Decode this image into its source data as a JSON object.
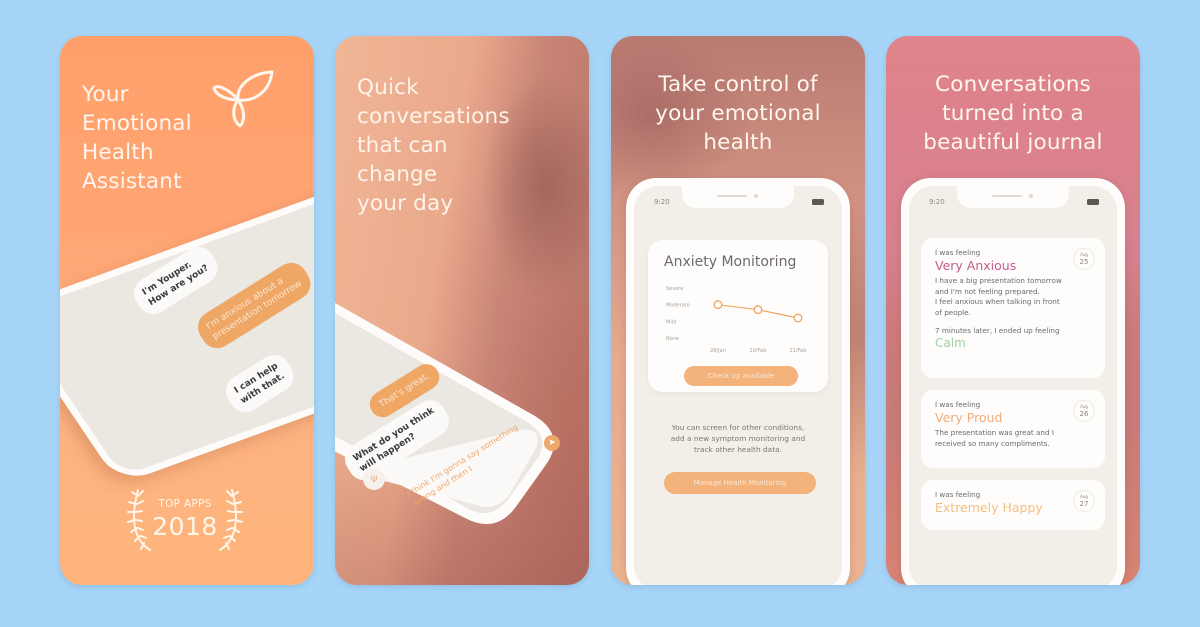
{
  "colors": {
    "background": "#a6d5f8",
    "accent_orange": "#efa766",
    "button_orange": "#f3b27a",
    "anxious_pink": "#c25b8d",
    "proud_orange": "#f2ab78",
    "happy_orange": "#f5be7c",
    "calm_green": "#9fd0a0"
  },
  "panels": [
    {
      "headline": [
        "Your",
        "Emotional",
        "Health",
        "Assistant"
      ],
      "logo_icon": "leaf-bird-logo-icon",
      "chat": [
        {
          "from": "bot",
          "text": [
            "I'm Youper.",
            "How are you?"
          ]
        },
        {
          "from": "user",
          "text": [
            "I'm anxious about a",
            "presentation tomorrow"
          ]
        },
        {
          "from": "bot",
          "text": [
            "I can help",
            "with that."
          ]
        }
      ],
      "award": {
        "label": "TOP APPS",
        "year": "2018",
        "icon": "laurel-wreath-icon"
      }
    },
    {
      "headline": [
        "Quick",
        "conversations",
        "that can",
        "change",
        "your day"
      ],
      "chat": [
        {
          "from": "user",
          "text": [
            "That's great."
          ]
        },
        {
          "from": "bot",
          "text": [
            "What do you think",
            "will happen?"
          ]
        },
        {
          "from": "user",
          "text": [
            "I think I'm gonna say something",
            "wrong and then I"
          ]
        }
      ],
      "send_icon": "send-arrow-icon",
      "avatar_icon": "youper-logo-icon"
    },
    {
      "headline": [
        "Take control of",
        "your emotional",
        "health"
      ],
      "status_time": "9:20",
      "monitor": {
        "title": "Anxiety Monitoring",
        "check_button": "Check up available",
        "description": [
          "You can screen for other conditions,",
          "add a new symptom monitoring and",
          "track other health data."
        ],
        "manage_button": "Manage Health Monitoring"
      }
    },
    {
      "headline": [
        "Conversations",
        "turned into a",
        "beautiful journal"
      ],
      "status_time": "9:20",
      "entries": [
        {
          "label": "I was feeling",
          "mood": "Very Anxious",
          "mood_color": "#c25b8d",
          "body": [
            "I have a big presentation tomorrow",
            "and I'm not feeling prepared.",
            "I feel anxious when talking in front",
            "of people."
          ],
          "after_label": "7 minutes later, I ended up feeling",
          "after_mood": "Calm",
          "date_month": "Aug",
          "date_day": "25"
        },
        {
          "label": "I was feeling",
          "mood": "Very Proud",
          "mood_color": "#f2ab78",
          "body": [
            "The presentation was great and I",
            "received so many compliments."
          ],
          "date_month": "Aug",
          "date_day": "26"
        },
        {
          "label": "I was feeling",
          "mood": "Extremely Happy",
          "mood_color": "#f5be7c",
          "body": [],
          "date_month": "Aug",
          "date_day": "27"
        }
      ]
    }
  ],
  "chart_data": {
    "type": "line",
    "title": "Anxiety Monitoring",
    "categories": [
      "28/Jan",
      "10/Feb",
      "21/Feb"
    ],
    "y_levels": [
      "None",
      "Mild",
      "Moderate",
      "Severe"
    ],
    "values": [
      2,
      1.7,
      1.2
    ],
    "ylim": [
      0,
      3
    ],
    "series_color": "#efa766",
    "grid": false
  }
}
